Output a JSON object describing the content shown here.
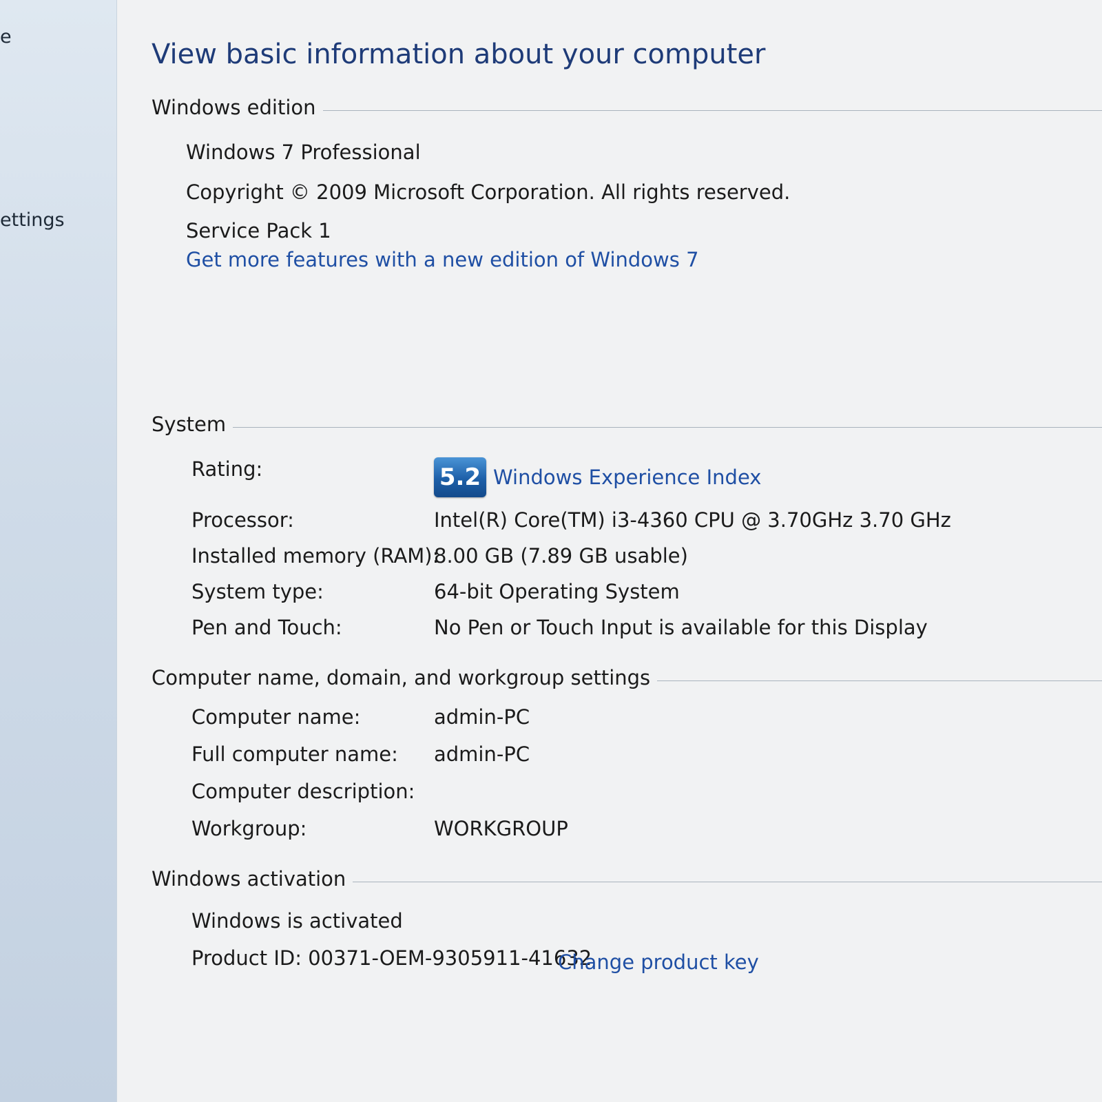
{
  "sidebar": {
    "fragments": [
      "e",
      "ettings"
    ]
  },
  "page_title": "View basic information about your computer",
  "windows_edition": {
    "header": "Windows edition",
    "edition": "Windows 7 Professional",
    "copyright": "Copyright © 2009 Microsoft Corporation.  All rights reserved.",
    "service_pack": "Service Pack 1",
    "upgrade_link": "Get more features with a new edition of Windows 7"
  },
  "system": {
    "header": "System",
    "rating_label": "Rating:",
    "rating_score": "5.2",
    "rating_link": "Windows Experience Index",
    "processor_label": "Processor:",
    "processor_value": "Intel(R) Core(TM) i3-4360 CPU @ 3.70GHz   3.70 GHz",
    "memory_label": "Installed memory (RAM):",
    "memory_value": "8.00 GB (7.89 GB usable)",
    "type_label": "System type:",
    "type_value": "64-bit Operating System",
    "pen_label": "Pen and Touch:",
    "pen_value": "No Pen or Touch Input is available for this Display"
  },
  "computer_name": {
    "header": "Computer name, domain, and workgroup settings",
    "name_label": "Computer name:",
    "name_value": "admin-PC",
    "full_label": "Full computer name:",
    "full_value": "admin-PC",
    "desc_label": "Computer description:",
    "desc_value": "",
    "workgroup_label": "Workgroup:",
    "workgroup_value": "WORKGROUP"
  },
  "activation": {
    "header": "Windows activation",
    "status": "Windows is activated",
    "product_id": "Product ID: 00371-OEM-9305911-41632",
    "change_key_link": "Change product key"
  },
  "colors": {
    "title": "#1e3b78",
    "link": "#1f4fa4",
    "badge": "#1d5fa8"
  }
}
